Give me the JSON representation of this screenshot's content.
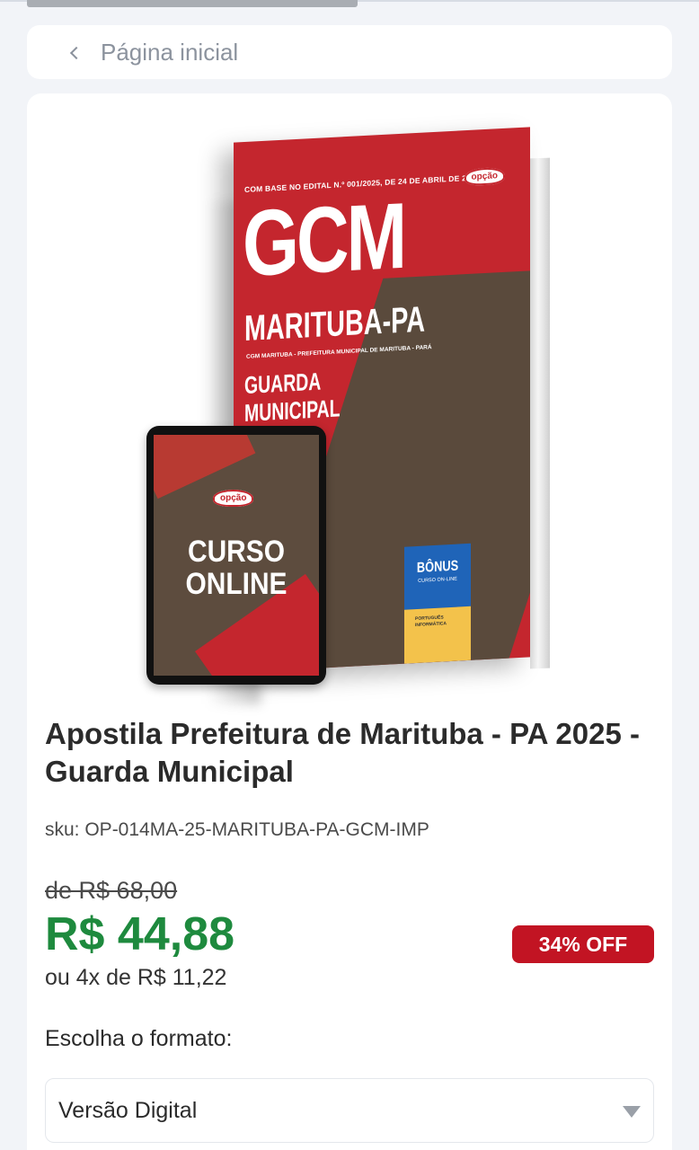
{
  "breadcrumb": {
    "label": "Página inicial",
    "icon": "chevron-left-icon"
  },
  "product_image": {
    "book": {
      "edital_line": "COM BASE NO EDITAL N.º 001/2025, DE 24 DE ABRIL DE 2025",
      "brand": "opção",
      "headline": "GCM",
      "city": "MARITUBA-PA",
      "subcity": "CGM MARITUBA - PREFEITURA MUNICIPAL DE MARITUBA - PARÁ",
      "role_line1": "GUARDA",
      "role_line2": "MUNICIPAL",
      "bonus_title": "BÔNUS",
      "bonus_sub": "CURSO ON-LINE",
      "bonus_items": "PORTUGUÊS INFORMÁTICA"
    },
    "tablet": {
      "brand": "opção",
      "line1": "CURSO",
      "line2": "ONLINE"
    }
  },
  "product": {
    "title": "Apostila Prefeitura de Marituba - PA 2025 - Guarda Municipal",
    "sku": "sku: OP-014MA-25-MARITUBA-PA-GCM-IMP",
    "old_price": "de R$ 68,00",
    "price": "R$ 44,88",
    "installments": "ou 4x de R$ 11,22",
    "discount_badge": "34% OFF"
  },
  "format": {
    "label": "Escolha o formato:",
    "selected": "Versão Digital"
  },
  "colors": {
    "price": "#1e8a3e",
    "badge": "#c21423",
    "cover": "#c4262e"
  }
}
